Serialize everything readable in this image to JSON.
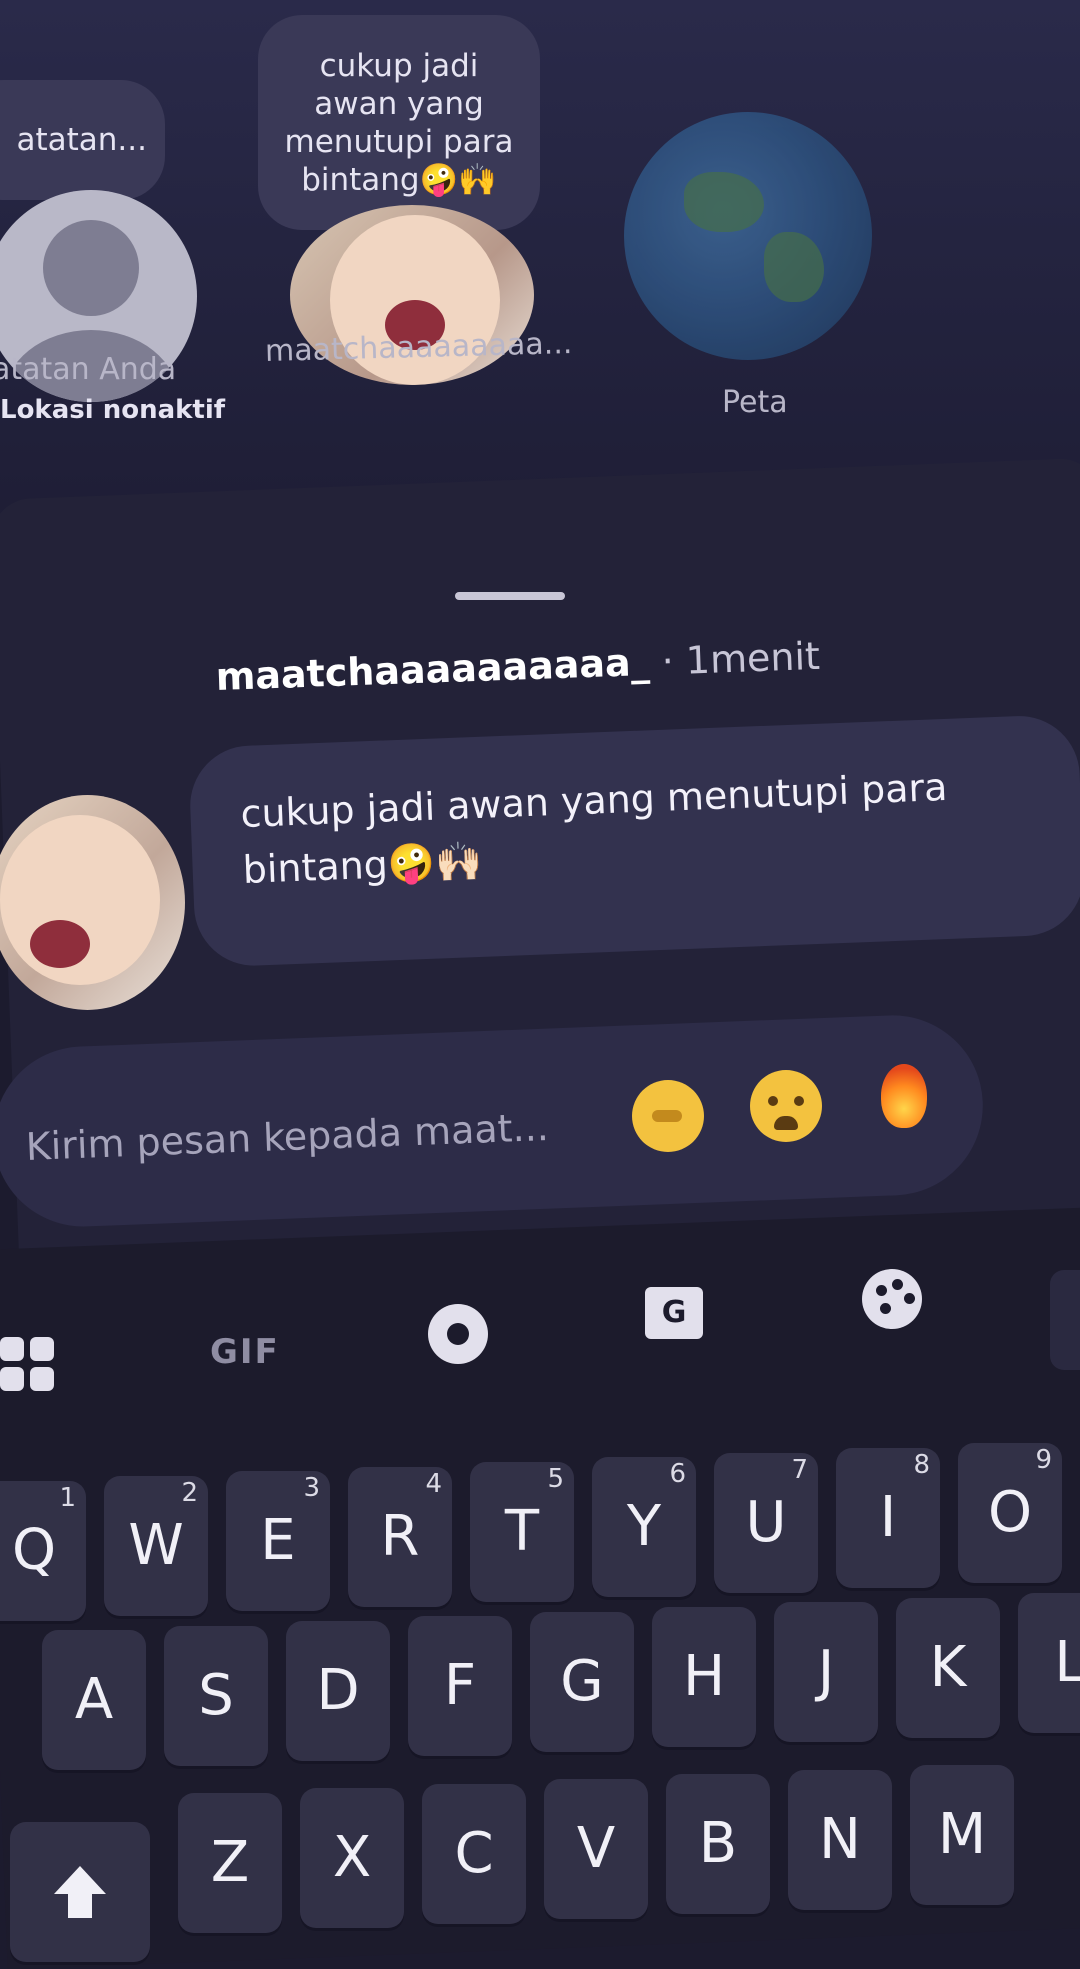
{
  "notes": {
    "own": {
      "bubble": "atatan...",
      "label": "atatan Anda",
      "sublabel": "Lokasi nonaktif"
    },
    "friend": {
      "bubble": "cukup jadi awan yang menutupi para bintang🤪🙌",
      "label": "maatchaaaaaaaaa..."
    },
    "map": {
      "label": "Peta"
    }
  },
  "message": {
    "sender": "maatchaaaaaaaaaa_",
    "separator": "·",
    "time": "1menit",
    "text": "cukup jadi awan yang menutupi para bintang🤪🙌🏻"
  },
  "composer": {
    "placeholder": "Kirim pesan kepada maat...",
    "reactions": [
      "point-icon",
      "weary-face-icon",
      "fire-icon"
    ]
  },
  "keyboard": {
    "toolbar": {
      "gif": "GIF",
      "translate": "G"
    },
    "row1": [
      {
        "k": "Q",
        "n": "1"
      },
      {
        "k": "W",
        "n": "2"
      },
      {
        "k": "E",
        "n": "3"
      },
      {
        "k": "R",
        "n": "4"
      },
      {
        "k": "T",
        "n": "5"
      },
      {
        "k": "Y",
        "n": "6"
      },
      {
        "k": "U",
        "n": "7"
      },
      {
        "k": "I",
        "n": "8"
      },
      {
        "k": "O",
        "n": "9"
      }
    ],
    "row2": [
      "A",
      "S",
      "D",
      "F",
      "G",
      "H",
      "J",
      "K",
      "L"
    ],
    "row3": [
      "Z",
      "X",
      "C",
      "V",
      "B",
      "N",
      "M"
    ]
  },
  "colors": {
    "background": "#1c1b2e",
    "bubble": "#33324f",
    "key": "#323147",
    "accent": "#ffffff"
  }
}
